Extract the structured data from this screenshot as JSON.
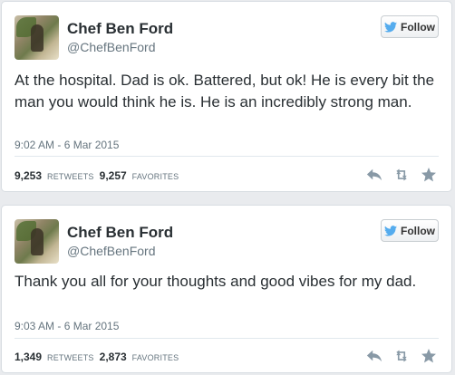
{
  "tweets": [
    {
      "name": "Chef Ben Ford",
      "handle": "@ChefBenFord",
      "follow_label": "Follow",
      "text": "At the hospital. Dad is ok. Battered, but ok! He is every bit the man you would think he is. He is an incredibly strong man.",
      "time": "9:02 AM - 6 Mar 2015",
      "retweets_count": "9,253",
      "retweets_label": "RETWEETS",
      "favorites_count": "9,257",
      "favorites_label": "FAVORITES"
    },
    {
      "name": "Chef Ben Ford",
      "handle": "@ChefBenFord",
      "follow_label": "Follow",
      "text": "Thank you all for your thoughts and good vibes for my dad.",
      "time": "9:03 AM - 6 Mar 2015",
      "retweets_count": "1,349",
      "retweets_label": "RETWEETS",
      "favorites_count": "2,873",
      "favorites_label": "FAVORITES"
    }
  ],
  "icons": {
    "follow": "twitter-bird-icon",
    "reply": "reply-icon",
    "retweet": "retweet-icon",
    "favorite": "star-icon"
  },
  "colors": {
    "accent": "#55acee",
    "text": "#292f33",
    "muted": "#66757f",
    "icon": "#8899a6"
  }
}
